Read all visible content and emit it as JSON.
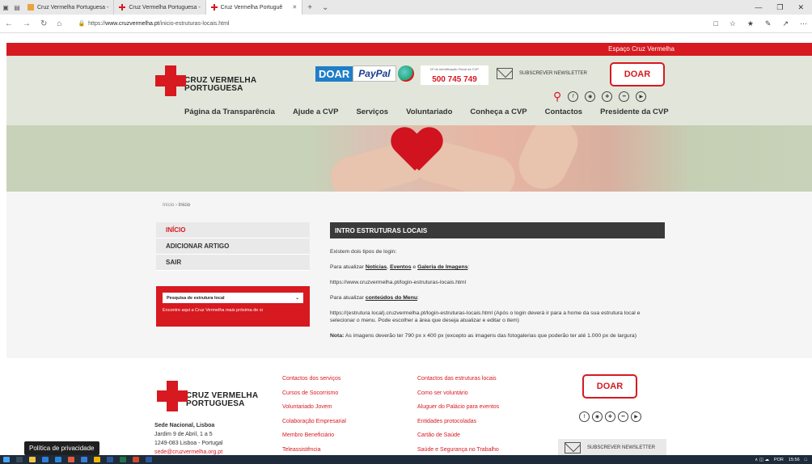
{
  "browser": {
    "tabs": [
      {
        "label": "Cruz Vermelha Portuguesa -"
      },
      {
        "label": "Cruz Vermelha Portuguesa -"
      },
      {
        "label": "Cruz Vermelha Portuguê"
      }
    ],
    "url_prefix": "https://",
    "url_domain": "www.cruzvermelha.pt",
    "url_path": "/inicio-estruturas-locais.html"
  },
  "header": {
    "espaco": "Espaço Cruz Vermelha",
    "logo_line1": "CRUZ VERMELHA",
    "logo_line2": "PORTUGUESA",
    "doar_label": "DOAR",
    "paypal_label": "PayPal",
    "nif_caption": "Nº de Identificação Fiscal da CVP",
    "nif_number": "500 745 749",
    "newsletter_label": "SUBSCREVER NEWSLETTER",
    "doar_button": "DOAR"
  },
  "nav": {
    "items": [
      "Página da Transparência",
      "Ajude a CVP",
      "Serviços",
      "Voluntariado",
      "Conheça a CVP",
      "Contactos",
      "Presidente da CVP"
    ]
  },
  "breadcrumb": {
    "home": "Início",
    "sep": "›",
    "current": "Início"
  },
  "sidemenu": {
    "items": [
      "INÍCIO",
      "ADICIONAR ARTIGO",
      "SAIR"
    ]
  },
  "localsearch": {
    "select_label": "Pesquisa de estrutura local",
    "subtitle": "Encontre aqui a Cruz Vermelha mais próxima de si"
  },
  "article": {
    "title": "INTRO ESTRUTURAS LOCAIS",
    "p1": "Existem dois tipos de login:",
    "p2_pre": "Para atualizar ",
    "p2_link1": "Notícias",
    "p2_sep1": ", ",
    "p2_link2": "Eventos",
    "p2_sep2": " e ",
    "p2_link3": "Galeria de Imagens",
    "p2_post": ":",
    "p3": "https://www.cruzvermelha.pt/login-estruturas-locais.html",
    "p4_pre": "Para atualizar ",
    "p4_link": "conteúdos do Menu",
    "p4_post": ":",
    "p5": "https://(estrutura local).cruzvermelha.pt/login-estruturas-locais.html (Após o login deverá ir para a home da sua estrutura local e selecionar o menu. Pode escolher a área que deseja atualizar e editar o item)",
    "p6_bold": "Nota:",
    "p6": " As imagens deverão ter 790 px x 400 px (excepto as imagens das fotogalerias que poderão ter até 1.000 px de largura)"
  },
  "footer": {
    "col1": [
      "Contactos dos serviços",
      "Cursos de Socorrismo",
      "Voluntariado Jovem",
      "Colaboração Empresarial",
      "Membro Beneficiário",
      "Teleassistência"
    ],
    "col2": [
      "Contactos das estruturas locais",
      "Como ser voluntário",
      "Aluguer do Palácio para eventos",
      "Entidades protocoladas",
      "Cartão de Saúde",
      "Saúde e Segurança no Trabalho"
    ],
    "addr_title": "Sede Nacional, Lisboa",
    "addr_line1": "Jardim 9 de Abril, 1 a 5",
    "addr_line2": "1249-083 Lisboa - Portugal",
    "addr_email": "sede@cruzvermelha.org.pt",
    "doar_button": "DOAR",
    "newsletter_label": "SUBSCREVER NEWSLETTER"
  },
  "privacy": "Política de privacidade",
  "taskbar": {
    "lang": "POR",
    "time": "15:56"
  }
}
